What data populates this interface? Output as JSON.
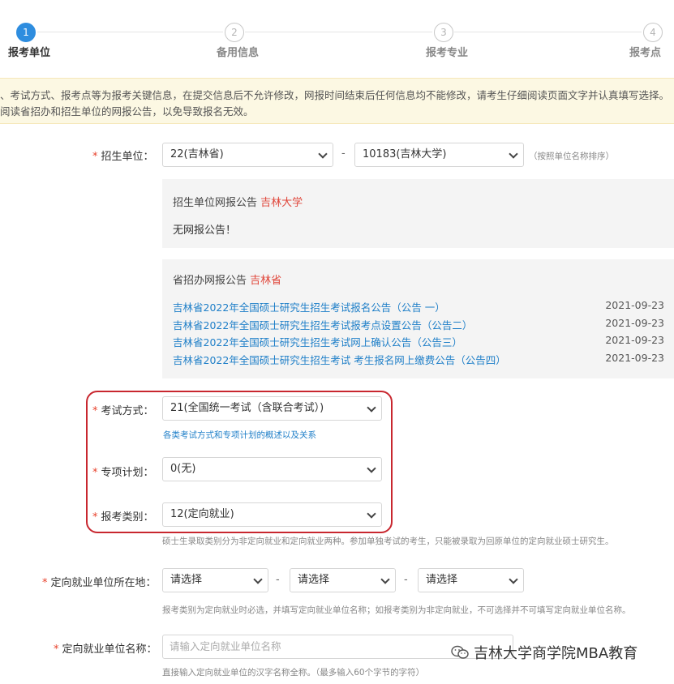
{
  "steps": [
    {
      "num": "1",
      "label": "报考单位"
    },
    {
      "num": "2",
      "label": "备用信息"
    },
    {
      "num": "3",
      "label": "报考专业"
    },
    {
      "num": "4",
      "label": "报考点"
    }
  ],
  "notice": {
    "line1": "、考试方式、报考点等为报考关键信息，在提交信息后不允许修改，网报时间结束后任何信息均不能修改，请考生仔细阅读页面文字并认真填写选择。",
    "line2": "阅读省招办和招生单位的网报公告，以免导致报名无效。"
  },
  "unit": {
    "label": "招生单位：",
    "province": "22(吉林省)",
    "school": "10183(吉林大学)",
    "hint": "（按照单位名称排序）"
  },
  "school_panel": {
    "title": "招生单位网报公告",
    "title_name": "吉林大学",
    "body": "无网报公告！"
  },
  "province_panel": {
    "title": "省招办网报公告",
    "title_name": "吉林省",
    "items": [
      {
        "title": "吉林省2022年全国硕士研究生招生考试报名公告（公告 一）",
        "date": "2021-09-23"
      },
      {
        "title": "吉林省2022年全国硕士研究生招生考试报考点设置公告（公告二）",
        "date": "2021-09-23"
      },
      {
        "title": "吉林省2022年全国硕士研究生招生考试网上确认公告（公告三）",
        "date": "2021-09-23"
      },
      {
        "title": "吉林省2022年全国硕士研究生招生考试 考生报名网上缴费公告（公告四）",
        "date": "2021-09-23"
      }
    ]
  },
  "exam_mode": {
    "label": "考试方式：",
    "value": "21(全国统一考试（含联合考试）)",
    "hint": "各类考试方式和专项计划的概述以及关系"
  },
  "special_plan": {
    "label": "专项计划：",
    "value": "0(无)"
  },
  "category": {
    "label": "报考类别：",
    "value": "12(定向就业)",
    "hint": "硕士生录取类别分为非定向就业和定向就业两种。参加单独考试的考生，只能被录取为回原单位的定向就业硕士研究生。"
  },
  "employer_location": {
    "label": "定向就业单位所在地：",
    "s1": "请选择",
    "s2": "请选择",
    "s3": "请选择",
    "hint": "报考类别为定向就业时必选，并填写定向就业单位名称；如报考类别为非定向就业，不可选择并不可填写定向就业单位名称。"
  },
  "employer_name": {
    "label": "定向就业单位名称：",
    "placeholder": "请输入定向就业单位名称",
    "hint": "直接输入定向就业单位的汉字名称全称。（最多输入60个字节的字符）"
  },
  "required_mark": "*",
  "dash": "-",
  "watermark": "吉林大学商学院MBA教育"
}
